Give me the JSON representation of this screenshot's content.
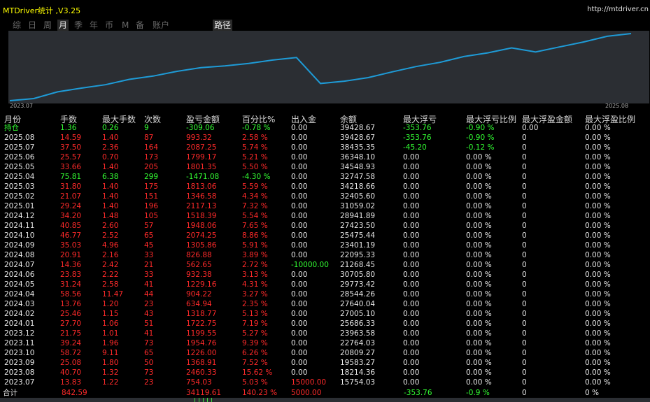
{
  "app": {
    "title": "MTDriver统计 ,V3.25",
    "site": "http://mtdriver.cn"
  },
  "tabs": [
    "综",
    "日",
    "周",
    "月",
    "季",
    "年",
    "币",
    "M",
    "备",
    "账户",
    "路径"
  ],
  "active_tabs": [
    "月",
    "路径"
  ],
  "chart_dates": {
    "start": "2023.07",
    "end": "2025.08"
  },
  "colors": {
    "profit": "#ff2a2a",
    "loss": "#33ff33",
    "line": "#1e9bd7",
    "panel": "#2b2e33"
  },
  "table": {
    "headers": [
      "月份",
      "手数",
      "最大手数",
      "次数",
      "盈亏金额",
      "百分比%",
      "出入金",
      "余额",
      "最大浮亏",
      "最大浮亏比例",
      "最大浮盈金额",
      "最大浮盈比例"
    ],
    "rows": [
      {
        "month": "持仓",
        "lots": "1.36",
        "max_lots": "0.26",
        "count": "9",
        "pnl": "-309.06",
        "pct": "-0.78 %",
        "flow": "0.00",
        "balance": "39428.67",
        "max_float_loss": "-353.76",
        "max_float_loss_pct": "-0.90 %",
        "max_float_profit": "0.00",
        "max_float_profit_pct": "0.00 %"
      },
      {
        "month": "2025.08",
        "lots": "14.59",
        "max_lots": "1.40",
        "count": "87",
        "pnl": "993.32",
        "pct": "2.58 %",
        "flow": "0.00",
        "balance": "39428.67",
        "max_float_loss": "-353.76",
        "max_float_loss_pct": "-0.90 %",
        "max_float_profit": "0",
        "max_float_profit_pct": "0.00 %"
      },
      {
        "month": "2025.07",
        "lots": "37.50",
        "max_lots": "2.36",
        "count": "164",
        "pnl": "2087.25",
        "pct": "5.74 %",
        "flow": "0.00",
        "balance": "38435.35",
        "max_float_loss": "-45.20",
        "max_float_loss_pct": "-0.12 %",
        "max_float_profit": "0",
        "max_float_profit_pct": "0.00 %"
      },
      {
        "month": "2025.06",
        "lots": "25.57",
        "max_lots": "0.70",
        "count": "173",
        "pnl": "1799.17",
        "pct": "5.21 %",
        "flow": "0.00",
        "balance": "36348.10",
        "max_float_loss": "0.00",
        "max_float_loss_pct": "0.00 %",
        "max_float_profit": "0",
        "max_float_profit_pct": "0.00 %"
      },
      {
        "month": "2025.05",
        "lots": "33.66",
        "max_lots": "1.40",
        "count": "205",
        "pnl": "1801.35",
        "pct": "5.50 %",
        "flow": "0.00",
        "balance": "34548.93",
        "max_float_loss": "0.00",
        "max_float_loss_pct": "0.00 %",
        "max_float_profit": "0",
        "max_float_profit_pct": "0.00 %"
      },
      {
        "month": "2025.04",
        "lots": "75.81",
        "max_lots": "6.38",
        "count": "299",
        "pnl": "-1471.08",
        "pct": "-4.30 %",
        "flow": "0.00",
        "balance": "32747.58",
        "max_float_loss": "0.00",
        "max_float_loss_pct": "0.00 %",
        "max_float_profit": "0",
        "max_float_profit_pct": "0.00 %"
      },
      {
        "month": "2025.03",
        "lots": "31.80",
        "max_lots": "1.40",
        "count": "175",
        "pnl": "1813.06",
        "pct": "5.59 %",
        "flow": "0.00",
        "balance": "34218.66",
        "max_float_loss": "0.00",
        "max_float_loss_pct": "0.00 %",
        "max_float_profit": "0",
        "max_float_profit_pct": "0.00 %"
      },
      {
        "month": "2025.02",
        "lots": "21.07",
        "max_lots": "1.40",
        "count": "151",
        "pnl": "1346.58",
        "pct": "4.34 %",
        "flow": "0.00",
        "balance": "32405.60",
        "max_float_loss": "0.00",
        "max_float_loss_pct": "0.00 %",
        "max_float_profit": "0",
        "max_float_profit_pct": "0.00 %"
      },
      {
        "month": "2025.01",
        "lots": "29.24",
        "max_lots": "1.40",
        "count": "196",
        "pnl": "2117.13",
        "pct": "7.32 %",
        "flow": "0.00",
        "balance": "31059.02",
        "max_float_loss": "0.00",
        "max_float_loss_pct": "0.00 %",
        "max_float_profit": "0",
        "max_float_profit_pct": "0.00 %"
      },
      {
        "month": "2024.12",
        "lots": "34.20",
        "max_lots": "1.48",
        "count": "105",
        "pnl": "1518.39",
        "pct": "5.54 %",
        "flow": "0.00",
        "balance": "28941.89",
        "max_float_loss": "0.00",
        "max_float_loss_pct": "0.00 %",
        "max_float_profit": "0",
        "max_float_profit_pct": "0.00 %"
      },
      {
        "month": "2024.11",
        "lots": "40.85",
        "max_lots": "2.60",
        "count": "57",
        "pnl": "1948.06",
        "pct": "7.65 %",
        "flow": "0.00",
        "balance": "27423.50",
        "max_float_loss": "0.00",
        "max_float_loss_pct": "0.00 %",
        "max_float_profit": "0",
        "max_float_profit_pct": "0.00 %"
      },
      {
        "month": "2024.10",
        "lots": "46.77",
        "max_lots": "2.52",
        "count": "65",
        "pnl": "2074.25",
        "pct": "8.86 %",
        "flow": "0.00",
        "balance": "25475.44",
        "max_float_loss": "0.00",
        "max_float_loss_pct": "0.00 %",
        "max_float_profit": "0",
        "max_float_profit_pct": "0.00 %"
      },
      {
        "month": "2024.09",
        "lots": "35.03",
        "max_lots": "4.96",
        "count": "45",
        "pnl": "1305.86",
        "pct": "5.91 %",
        "flow": "0.00",
        "balance": "23401.19",
        "max_float_loss": "0.00",
        "max_float_loss_pct": "0.00 %",
        "max_float_profit": "0",
        "max_float_profit_pct": "0.00 %"
      },
      {
        "month": "2024.08",
        "lots": "20.91",
        "max_lots": "2.16",
        "count": "33",
        "pnl": "826.88",
        "pct": "3.89 %",
        "flow": "0.00",
        "balance": "22095.33",
        "max_float_loss": "0.00",
        "max_float_loss_pct": "0.00 %",
        "max_float_profit": "0",
        "max_float_profit_pct": "0.00 %"
      },
      {
        "month": "2024.07",
        "lots": "14.36",
        "max_lots": "2.42",
        "count": "21",
        "pnl": "562.65",
        "pct": "2.72 %",
        "flow": "-10000.00",
        "balance": "21268.45",
        "max_float_loss": "0.00",
        "max_float_loss_pct": "0.00 %",
        "max_float_profit": "0",
        "max_float_profit_pct": "0.00 %"
      },
      {
        "month": "2024.06",
        "lots": "23.83",
        "max_lots": "2.22",
        "count": "33",
        "pnl": "932.38",
        "pct": "3.13 %",
        "flow": "0.00",
        "balance": "30705.80",
        "max_float_loss": "0.00",
        "max_float_loss_pct": "0.00 %",
        "max_float_profit": "0",
        "max_float_profit_pct": "0.00 %"
      },
      {
        "month": "2024.05",
        "lots": "31.24",
        "max_lots": "2.58",
        "count": "41",
        "pnl": "1229.16",
        "pct": "4.31 %",
        "flow": "0.00",
        "balance": "29773.42",
        "max_float_loss": "0.00",
        "max_float_loss_pct": "0.00 %",
        "max_float_profit": "0",
        "max_float_profit_pct": "0.00 %"
      },
      {
        "month": "2024.04",
        "lots": "58.56",
        "max_lots": "11.47",
        "count": "44",
        "pnl": "904.22",
        "pct": "3.27 %",
        "flow": "0.00",
        "balance": "28544.26",
        "max_float_loss": "0.00",
        "max_float_loss_pct": "0.00 %",
        "max_float_profit": "0",
        "max_float_profit_pct": "0.00 %"
      },
      {
        "month": "2024.03",
        "lots": "13.76",
        "max_lots": "1.20",
        "count": "23",
        "pnl": "634.94",
        "pct": "2.35 %",
        "flow": "0.00",
        "balance": "27640.04",
        "max_float_loss": "0.00",
        "max_float_loss_pct": "0.00 %",
        "max_float_profit": "0",
        "max_float_profit_pct": "0.00 %"
      },
      {
        "month": "2024.02",
        "lots": "25.46",
        "max_lots": "1.15",
        "count": "43",
        "pnl": "1318.77",
        "pct": "5.13 %",
        "flow": "0.00",
        "balance": "27005.10",
        "max_float_loss": "0.00",
        "max_float_loss_pct": "0.00 %",
        "max_float_profit": "0",
        "max_float_profit_pct": "0.00 %"
      },
      {
        "month": "2024.01",
        "lots": "27.70",
        "max_lots": "1.06",
        "count": "51",
        "pnl": "1722.75",
        "pct": "7.19 %",
        "flow": "0.00",
        "balance": "25686.33",
        "max_float_loss": "0.00",
        "max_float_loss_pct": "0.00 %",
        "max_float_profit": "0",
        "max_float_profit_pct": "0.00 %"
      },
      {
        "month": "2023.12",
        "lots": "21.75",
        "max_lots": "1.01",
        "count": "41",
        "pnl": "1199.55",
        "pct": "5.27 %",
        "flow": "0.00",
        "balance": "23963.58",
        "max_float_loss": "0.00",
        "max_float_loss_pct": "0.00 %",
        "max_float_profit": "0",
        "max_float_profit_pct": "0.00 %"
      },
      {
        "month": "2023.11",
        "lots": "39.24",
        "max_lots": "1.96",
        "count": "73",
        "pnl": "1954.76",
        "pct": "9.39 %",
        "flow": "0.00",
        "balance": "22764.03",
        "max_float_loss": "0.00",
        "max_float_loss_pct": "0.00 %",
        "max_float_profit": "0",
        "max_float_profit_pct": "0.00 %"
      },
      {
        "month": "2023.10",
        "lots": "58.72",
        "max_lots": "9.11",
        "count": "65",
        "pnl": "1226.00",
        "pct": "6.26 %",
        "flow": "0.00",
        "balance": "20809.27",
        "max_float_loss": "0.00",
        "max_float_loss_pct": "0.00 %",
        "max_float_profit": "0",
        "max_float_profit_pct": "0.00 %"
      },
      {
        "month": "2023.09",
        "lots": "25.08",
        "max_lots": "1.80",
        "count": "50",
        "pnl": "1368.91",
        "pct": "7.52 %",
        "flow": "0.00",
        "balance": "19583.27",
        "max_float_loss": "0.00",
        "max_float_loss_pct": "0.00 %",
        "max_float_profit": "0",
        "max_float_profit_pct": "0.00 %"
      },
      {
        "month": "2023.08",
        "lots": "40.70",
        "max_lots": "1.32",
        "count": "73",
        "pnl": "2460.33",
        "pct": "15.62 %",
        "flow": "0.00",
        "balance": "18214.36",
        "max_float_loss": "0.00",
        "max_float_loss_pct": "0.00 %",
        "max_float_profit": "0",
        "max_float_profit_pct": "0.00 %"
      },
      {
        "month": "2023.07",
        "lots": "13.83",
        "max_lots": "1.22",
        "count": "23",
        "pnl": "754.03",
        "pct": "5.03 %",
        "flow": "15000.00",
        "balance": "15754.03",
        "max_float_loss": "0.00",
        "max_float_loss_pct": "0.00 %",
        "max_float_profit": "0",
        "max_float_profit_pct": "0.00 %"
      }
    ],
    "total": {
      "month": "合计",
      "lots": "842.59",
      "pnl": "34119.61",
      "pct": "140.23 %",
      "flow": "5000.00",
      "max_float_loss": "-353.76",
      "max_float_loss_pct": "-0.9 %",
      "max_float_profit": "0",
      "max_float_profit_pct": "0 %"
    }
  }
}
